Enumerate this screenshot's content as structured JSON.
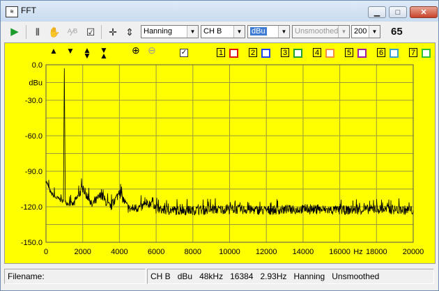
{
  "window": {
    "title": "FFT",
    "icon": "fft-app-icon"
  },
  "toolbar": {
    "window_select": "Hanning",
    "channel_select": "CH B",
    "unit_select": "dBu",
    "smoothing_select": "Unsmoothed",
    "zoom_select": "200",
    "average_count": "65"
  },
  "plot_controls": {
    "trace_numbers": [
      "1",
      "2",
      "3",
      "4",
      "5",
      "6",
      "7"
    ],
    "trace_colors": [
      "#e01010",
      "#2040ff",
      "#20a030",
      "#f09040",
      "#a020a0",
      "#3aa0d0",
      "#30c030"
    ]
  },
  "chart_data": {
    "type": "line",
    "ylabel": "dBu",
    "xlabel": "Hz",
    "xlim": [
      0,
      20000
    ],
    "ylim": [
      -150,
      0
    ],
    "grid": true,
    "background": "#ffff00",
    "line_color": "#000000",
    "x_ticks": [
      "0",
      "2000",
      "4000",
      "6000",
      "8000",
      "10000",
      "12000",
      "14000",
      "16000",
      "18000",
      "20000"
    ],
    "y_ticks": [
      "0.0",
      "-30.0",
      "-60.0",
      "-90.0",
      "-120.0",
      "-150.0"
    ],
    "series": [
      {
        "x": [
          0,
          100,
          250,
          500,
          800,
          950,
          1000,
          1050,
          1200,
          1500,
          2000,
          2500,
          3000,
          3500,
          4000,
          4500,
          5000,
          5500,
          5800,
          6000,
          6500,
          8000,
          10000,
          12000,
          14000,
          16000,
          18000,
          20000
        ],
        "y": [
          -98,
          -102,
          -108,
          -112,
          -114,
          -116,
          -3,
          -116,
          -117,
          -118,
          -104,
          -119,
          -110,
          -121,
          -108,
          -122,
          -121,
          -119,
          -115,
          -122,
          -123,
          -123,
          -122,
          -123,
          -122,
          -123,
          -122,
          -123
        ]
      }
    ]
  },
  "statusbar": {
    "filename_label": "Filename:",
    "channel": "CH B",
    "unit": "dBu",
    "sample_rate": "48kHz",
    "fft_size": "16384",
    "resolution": "2.93Hz",
    "window": "Hanning",
    "smoothing": "Unsmoothed"
  }
}
